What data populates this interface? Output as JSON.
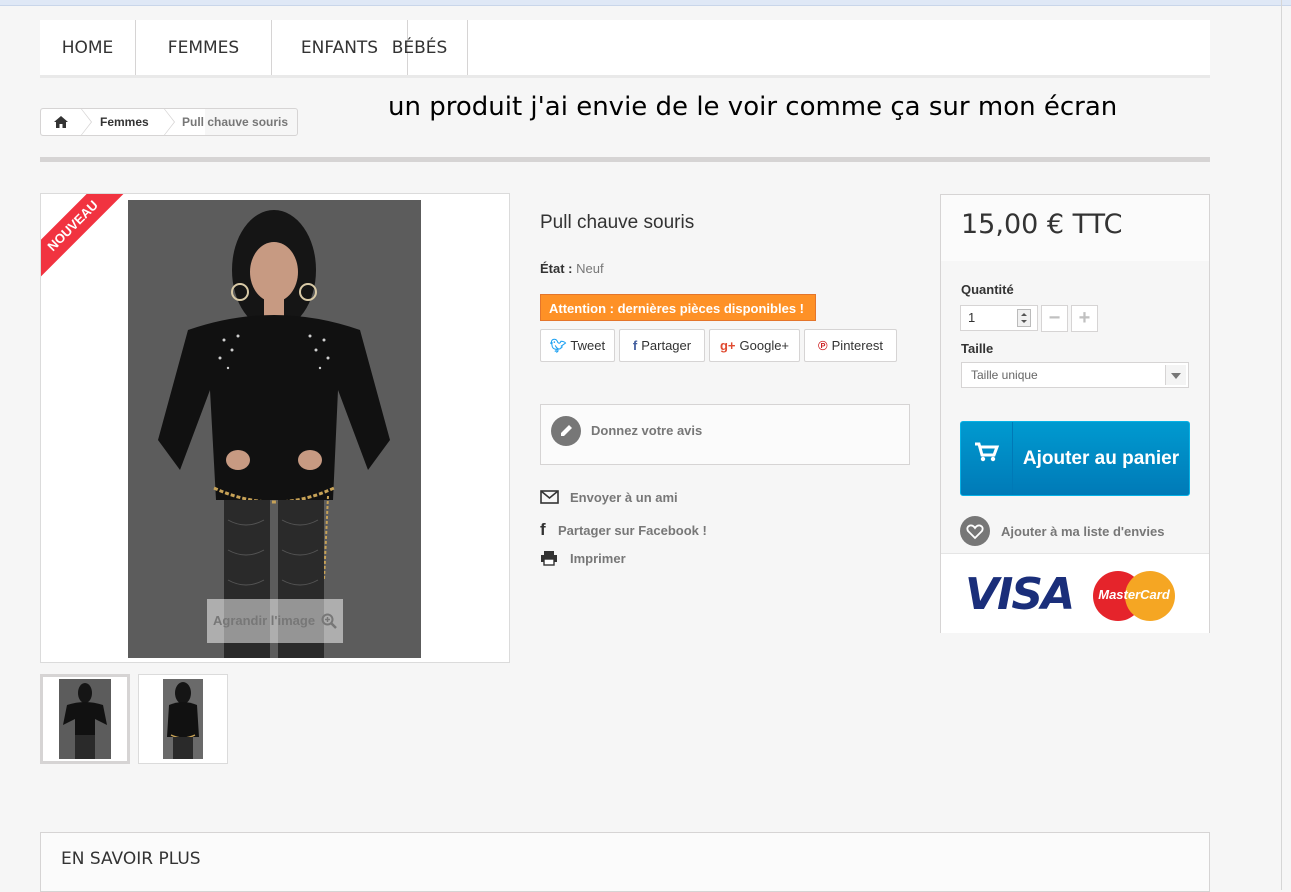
{
  "menu": {
    "items": [
      {
        "label": "HOME"
      },
      {
        "label": "FEMMES"
      },
      {
        "label": "ENFANTS"
      },
      {
        "label": "BÉBÉS"
      }
    ]
  },
  "breadcrumb": {
    "home_icon": "home-icon",
    "category": "Femmes",
    "current": "Pull chauve souris"
  },
  "annotation": "un produit j'ai envie de le voir comme ça sur mon écran",
  "product": {
    "badge": "NOUVEAU",
    "zoom_label": "Agrandir l'image",
    "title": "Pull chauve souris",
    "condition_label": "État :",
    "condition_value": "Neuf",
    "alert": "Attention : dernières pièces disponibles !"
  },
  "social": {
    "tweet": "Tweet",
    "share": "Partager",
    "google": "Google+",
    "pinterest": "Pinterest"
  },
  "review": {
    "label": "Donnez votre avis"
  },
  "actions": {
    "send_friend": "Envoyer à un ami",
    "share_facebook": "Partager sur Facebook !",
    "print": "Imprimer"
  },
  "buy": {
    "price": "15,00 € TTC",
    "quantity_label": "Quantité",
    "quantity_value": "1",
    "minus": "−",
    "plus": "+",
    "size_label": "Taille",
    "size_value": "Taille unique",
    "add_to_cart": "Ajouter au panier",
    "wishlist": "Ajouter à ma liste d'envies",
    "visa": "VISA",
    "mastercard": "MasterCard"
  },
  "more_info": {
    "heading": "EN SAVOIR PLUS"
  },
  "colors": {
    "alert_orange": "#fe9126",
    "cart_blue": "#0089c9",
    "ribbon_red": "#f13340"
  }
}
